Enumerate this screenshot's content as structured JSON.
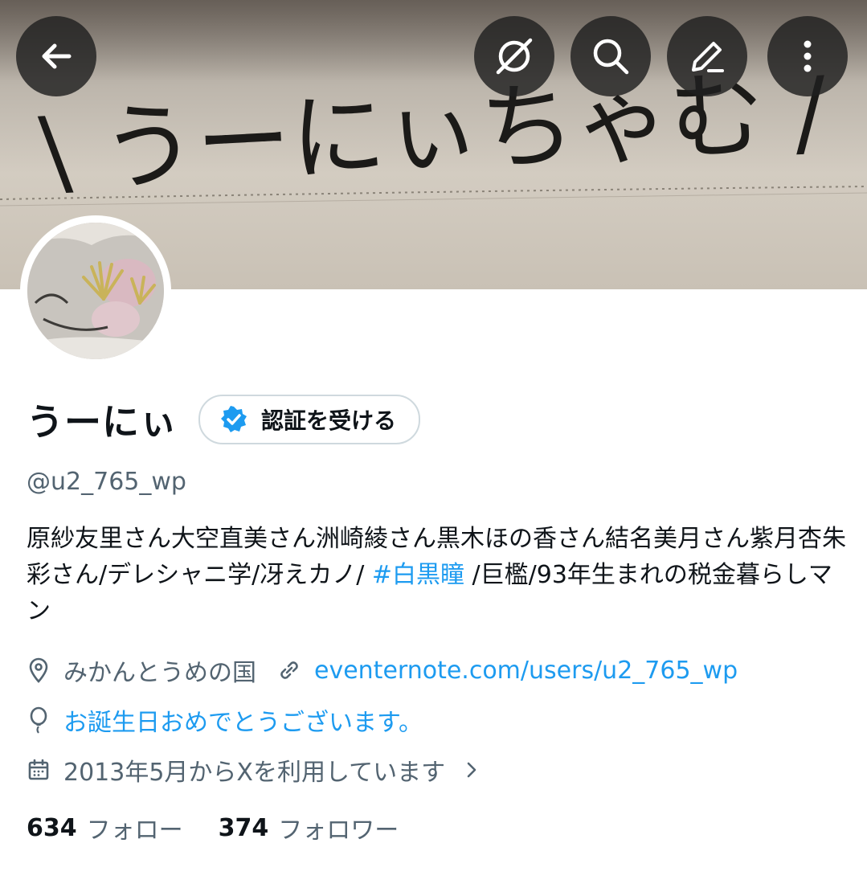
{
  "header": {
    "banner_text": "\\ うーにぃちゃむ /",
    "buttons": {
      "back_icon": "arrow-left-icon",
      "grok_icon": "grok-icon",
      "search_icon": "search-icon",
      "edit_icon": "edit-icon",
      "more_icon": "more-vertical-icon"
    }
  },
  "profile": {
    "display_name": "うーにぃ",
    "verify_label": "認証を受ける",
    "handle": "@u2_765_wp",
    "bio_before": "原紗友里さん大空直美さん洲崎綾さん黒木ほの香さん結名美月さん紫月杏朱彩さん/デレシャニ学/冴えカノ/ ",
    "bio_hashtag": "#白黒瞳",
    "bio_after": " /巨檻/93年生まれの税金暮らしマン",
    "location": "みかんとうめの国",
    "website": "eventernote.com/users/u2_765_wp",
    "birthday": "お誕生日おめでとうございます。",
    "joined": "2013年5月からXを利用しています",
    "following_count": "634",
    "following_label": "フォロー",
    "followers_count": "374",
    "followers_label": "フォロワー"
  },
  "colors": {
    "accent": "#1d9bf0",
    "text": "#0f1419",
    "muted": "#536471",
    "border": "#cfd9de"
  }
}
